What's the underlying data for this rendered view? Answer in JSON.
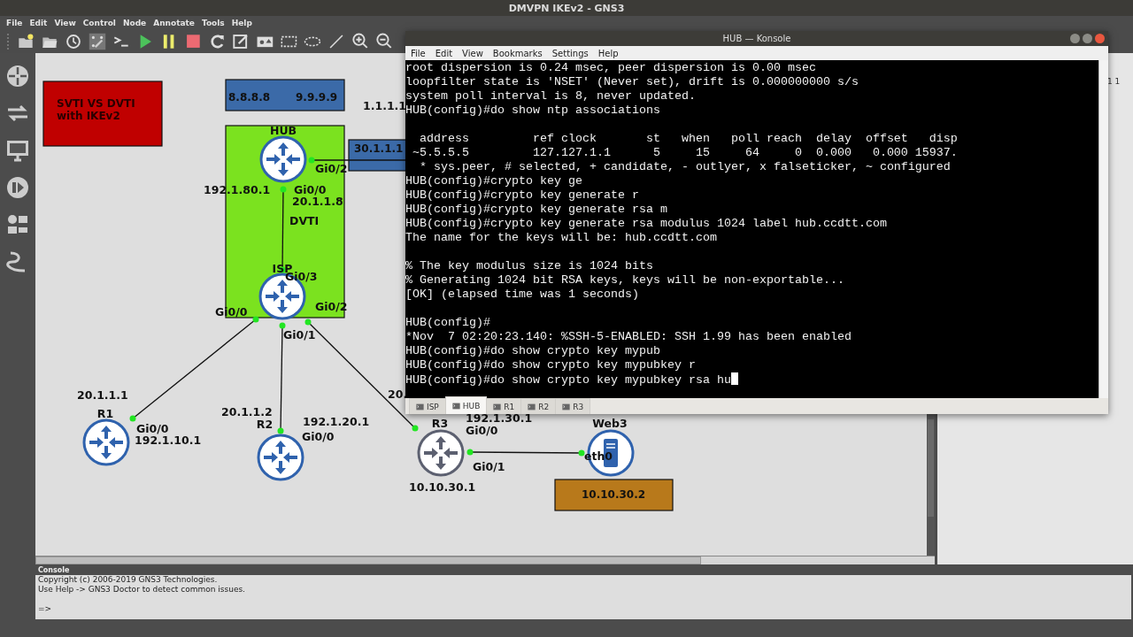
{
  "window": {
    "title": "DMVPN IKEv2 - GNS3"
  },
  "menu": [
    "File",
    "Edit",
    "View",
    "Control",
    "Node",
    "Annotate",
    "Tools",
    "Help"
  ],
  "canvas": {
    "shapes": [
      {
        "color": "#c00000",
        "texts": [
          "SVTI VS DVTI",
          "with IKEv2"
        ]
      },
      {
        "color": "#3b6aa8",
        "texts": [
          "8.8.8.8",
          "9.9.9.9"
        ]
      },
      {
        "color": "#7be21f"
      },
      {
        "color": "#3b6aa8",
        "texts": [
          "30.1.1.1"
        ]
      },
      {
        "color": "#b8791b",
        "texts": [
          "10.10.30.2"
        ]
      }
    ],
    "nodes": [
      {
        "name": "HUB",
        "kind": "router",
        "running": true
      },
      {
        "name": "ISP",
        "kind": "router",
        "running": true
      },
      {
        "name": "R1",
        "kind": "router",
        "running": true
      },
      {
        "name": "R2",
        "kind": "router",
        "running": true
      },
      {
        "name": "R3",
        "kind": "router",
        "running": false
      },
      {
        "name": "Web3",
        "kind": "server",
        "running": true
      }
    ],
    "labels": [
      "1.1.1.1",
      "Gi0/2",
      "192.1.80.1",
      "Gi0/0",
      "20.1.1.8",
      "DVTI",
      "Gi0/3",
      "Gi0/2",
      "Gi0/0",
      "Gi0/1",
      "20.",
      "20.1.1.1",
      "20.1.1.2",
      "192.1.30.1",
      "192.1.20.1",
      "Gi0/0",
      "Gi0/0",
      "Gi0/0",
      "192.1.10.1",
      "eth0",
      "Gi0/1",
      "10.10.30.1"
    ]
  },
  "right_panel": {
    "text": "1 1"
  },
  "konsole": {
    "title": "HUB — Konsole",
    "menu": [
      "File",
      "Edit",
      "View",
      "Bookmarks",
      "Settings",
      "Help"
    ],
    "blocks": [
      [
        "root dispersion is 0.24 msec, peer dispersion is 0.00 msec",
        "loopfilter state is 'NSET' (Never set), drift is 0.000000000 s/s",
        "system poll interval is 8, never updated.",
        "HUB(config)#do show ntp associations"
      ],
      [
        "  address         ref clock       st   when   poll reach  delay  offset   disp",
        " ~5.5.5.5         127.127.1.1      5     15     64     0  0.000   0.000 15937.",
        "  * sys.peer, # selected, + candidate, - outlyer, x falseticker, ~ configured",
        "HUB(config)#crypto key ge",
        "HUB(config)#crypto key generate r",
        "HUB(config)#crypto key generate rsa m",
        "HUB(config)#crypto key generate rsa modulus 1024 label hub.ccdtt.com",
        "The name for the keys will be: hub.ccdtt.com"
      ],
      [
        "% The key modulus size is 1024 bits",
        "% Generating 1024 bit RSA keys, keys will be non-exportable...",
        "[OK] (elapsed time was 1 seconds)"
      ],
      [
        "HUB(config)#",
        "*Nov  7 02:20:23.140: %SSH-5-ENABLED: SSH 1.99 has been enabled",
        "HUB(config)#do show crypto key mypub",
        "HUB(config)#do show crypto key mypubkey r",
        "HUB(config)#do show crypto key mypubkey rsa hu"
      ]
    ],
    "tabs": [
      {
        "label": "ISP",
        "selected": false
      },
      {
        "label": "HUB",
        "selected": true
      },
      {
        "label": "R1",
        "selected": false
      },
      {
        "label": "R2",
        "selected": false
      },
      {
        "label": "R3",
        "selected": false
      }
    ]
  },
  "console": {
    "title": "Console",
    "lines": [
      "Copyright (c) 2006-2019 GNS3 Technologies.",
      "Use Help -> GNS3 Doctor to detect common issues."
    ],
    "prompt": "=>"
  }
}
